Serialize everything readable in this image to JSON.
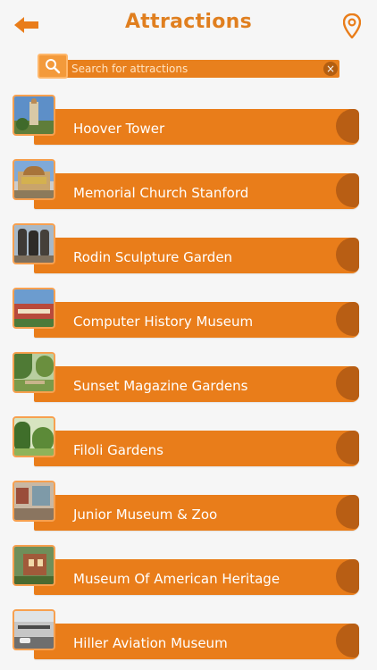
{
  "header": {
    "title": "Attractions",
    "back_icon": "arrow-left-icon",
    "location_icon": "map-pin-icon"
  },
  "search": {
    "placeholder": "Search for attractions",
    "value": "",
    "icon": "search-icon",
    "clear_icon": "close-icon"
  },
  "colors": {
    "accent": "#e97d1a",
    "accent_dark": "#b85e14",
    "title": "#e07f1f",
    "background": "#f6f6f6"
  },
  "attractions": [
    {
      "name": "Hoover Tower",
      "thumbnail": "tower-photo"
    },
    {
      "name": "Memorial Church Stanford",
      "thumbnail": "church-photo"
    },
    {
      "name": "Rodin Sculpture Garden",
      "thumbnail": "sculpture-photo"
    },
    {
      "name": "Computer History Museum",
      "thumbnail": "museum-photo"
    },
    {
      "name": "Sunset Magazine Gardens",
      "thumbnail": "garden-photo"
    },
    {
      "name": "Filoli Gardens",
      "thumbnail": "garden-photo"
    },
    {
      "name": "Junior Museum & Zoo",
      "thumbnail": "museum-photo"
    },
    {
      "name": "Museum Of American Heritage",
      "thumbnail": "house-photo"
    },
    {
      "name": "Hiller Aviation Museum",
      "thumbnail": "building-photo"
    }
  ]
}
